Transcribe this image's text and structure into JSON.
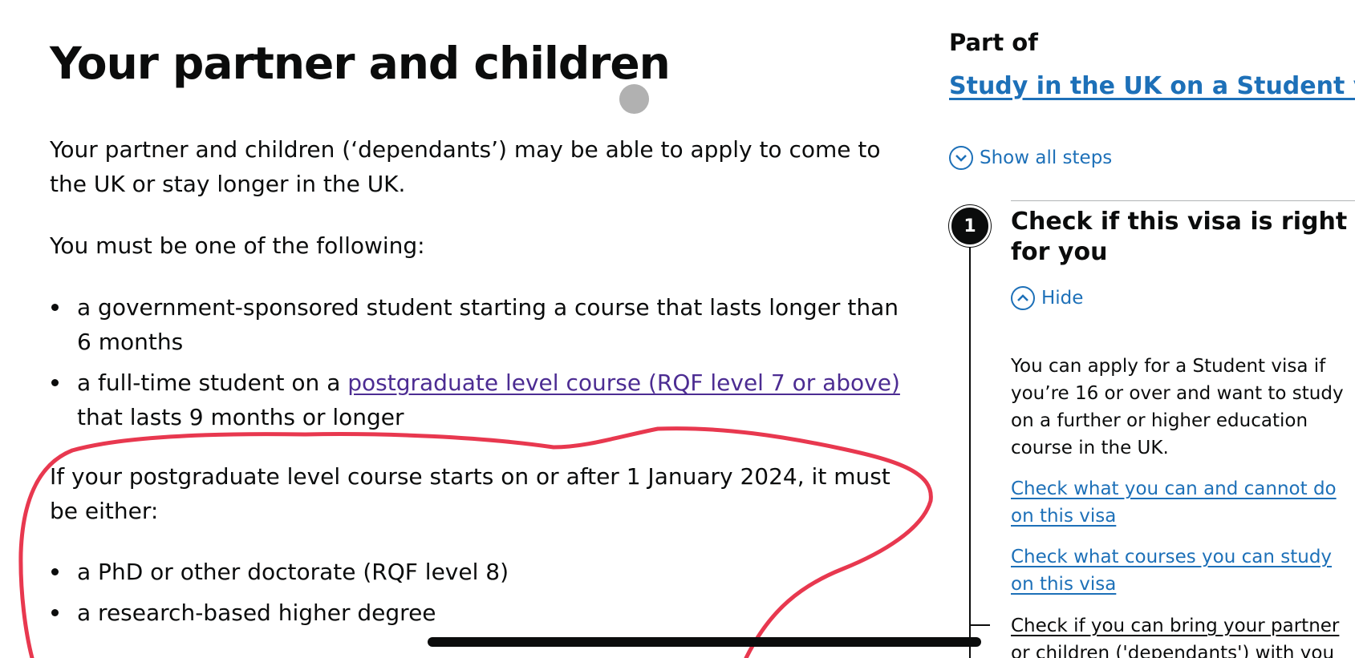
{
  "main": {
    "title": "Your partner and children",
    "intro": "Your partner and children (‘dependants’) may be able to apply to come to the UK or stay longer in the UK.",
    "must_be": "You must be one of the following:",
    "list_one": {
      "item1": "a government-sponsored student starting a course that lasts longer than 6 months",
      "item2_prefix": "a full-time student on a ",
      "item2_link": "postgraduate level course (RQF level 7 or above)",
      "item2_suffix": " that lasts 9 months or longer"
    },
    "postgrad_rule": "If your postgraduate level course starts on or after 1 January 2024, it must be either:",
    "list_two": {
      "item1": "a PhD or other doctorate (RQF level 8)",
      "item2": "a research-based higher degree"
    }
  },
  "sidebar": {
    "part_of": "Part of",
    "parent_link": "Study in the UK on a Student visa",
    "show_all": "Show all steps",
    "step": {
      "number": "1",
      "title": "Check if this visa is right for you",
      "hide": "Hide",
      "description": "You can apply for a Student visa if you’re 16 or over and want to study on a further or higher education course in the UK.",
      "links": [
        "Check what you can and cannot do on this visa",
        "Check what courses you can study on this visa",
        "Check if you can bring your partner or children ('dependants') with you"
      ]
    }
  },
  "colors": {
    "link": "#1d70b8",
    "visited_link": "#4c2c92",
    "text": "#0b0c0c",
    "annotation": "#e8384f"
  },
  "icons": {
    "show_all": "chevron-down-circle-icon",
    "hide": "chevron-up-circle-icon"
  }
}
